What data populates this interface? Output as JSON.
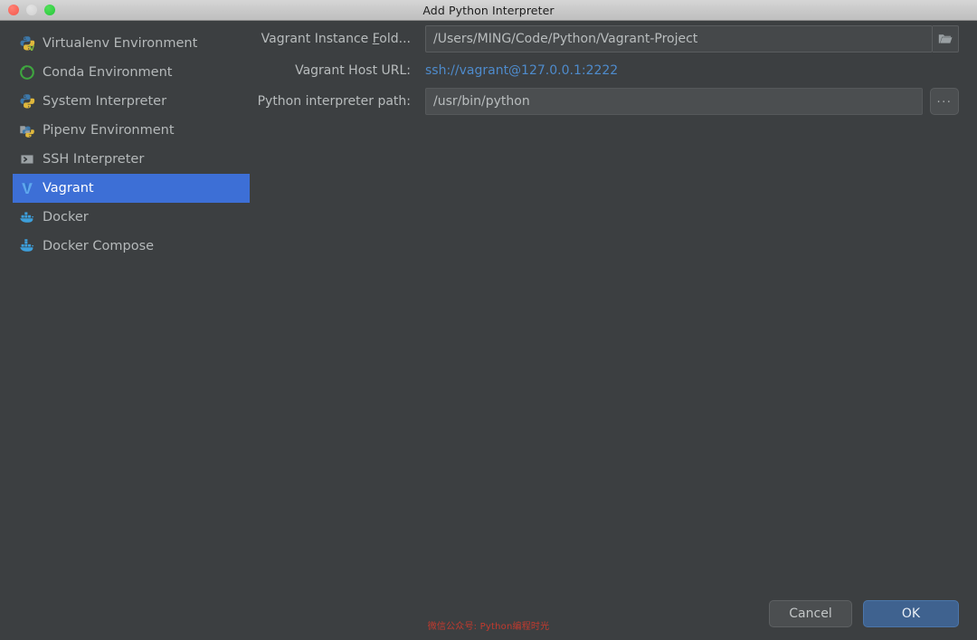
{
  "window": {
    "title": "Add Python Interpreter",
    "traffic_lights": [
      {
        "name": "close",
        "color": "#f4584c"
      },
      {
        "name": "minimize",
        "color": "#d2d2d2"
      },
      {
        "name": "zoom",
        "color": "#25c63a"
      }
    ]
  },
  "sidebar": {
    "items": [
      {
        "label": "Virtualenv Environment",
        "icon": "python-virtualenv-icon",
        "selected": false
      },
      {
        "label": "Conda Environment",
        "icon": "conda-icon",
        "selected": false
      },
      {
        "label": "System Interpreter",
        "icon": "python-icon",
        "selected": false
      },
      {
        "label": "Pipenv Environment",
        "icon": "pipenv-icon",
        "selected": false
      },
      {
        "label": "SSH Interpreter",
        "icon": "terminal-icon",
        "selected": false
      },
      {
        "label": "Vagrant",
        "icon": "vagrant-icon",
        "selected": true
      },
      {
        "label": "Docker",
        "icon": "docker-icon",
        "selected": false
      },
      {
        "label": "Docker Compose",
        "icon": "docker-compose-icon",
        "selected": false
      }
    ],
    "selected_index": 5,
    "selection_color": "#3d6fd6"
  },
  "form": {
    "vagrant_instance_folder": {
      "label_prefix": "Vagrant Instance ",
      "label_mnemonic": "F",
      "label_suffix": "old...",
      "value": "/Users/MING/Code/Python/Vagrant-Project",
      "browse_icon": "folder-open-icon"
    },
    "vagrant_host_url": {
      "label": "Vagrant Host URL:",
      "value": "ssh://vagrant@127.0.0.1:2222",
      "link_color": "#4e8bcc"
    },
    "python_interpreter_path": {
      "label": "Python interpreter path:",
      "value": "/usr/bin/python",
      "browse_label": "..."
    }
  },
  "footer": {
    "watermark": "微信公众号: Python编程时光",
    "watermark_color": "#c33a2e",
    "cancel_label": "Cancel",
    "ok_label": "OK"
  }
}
